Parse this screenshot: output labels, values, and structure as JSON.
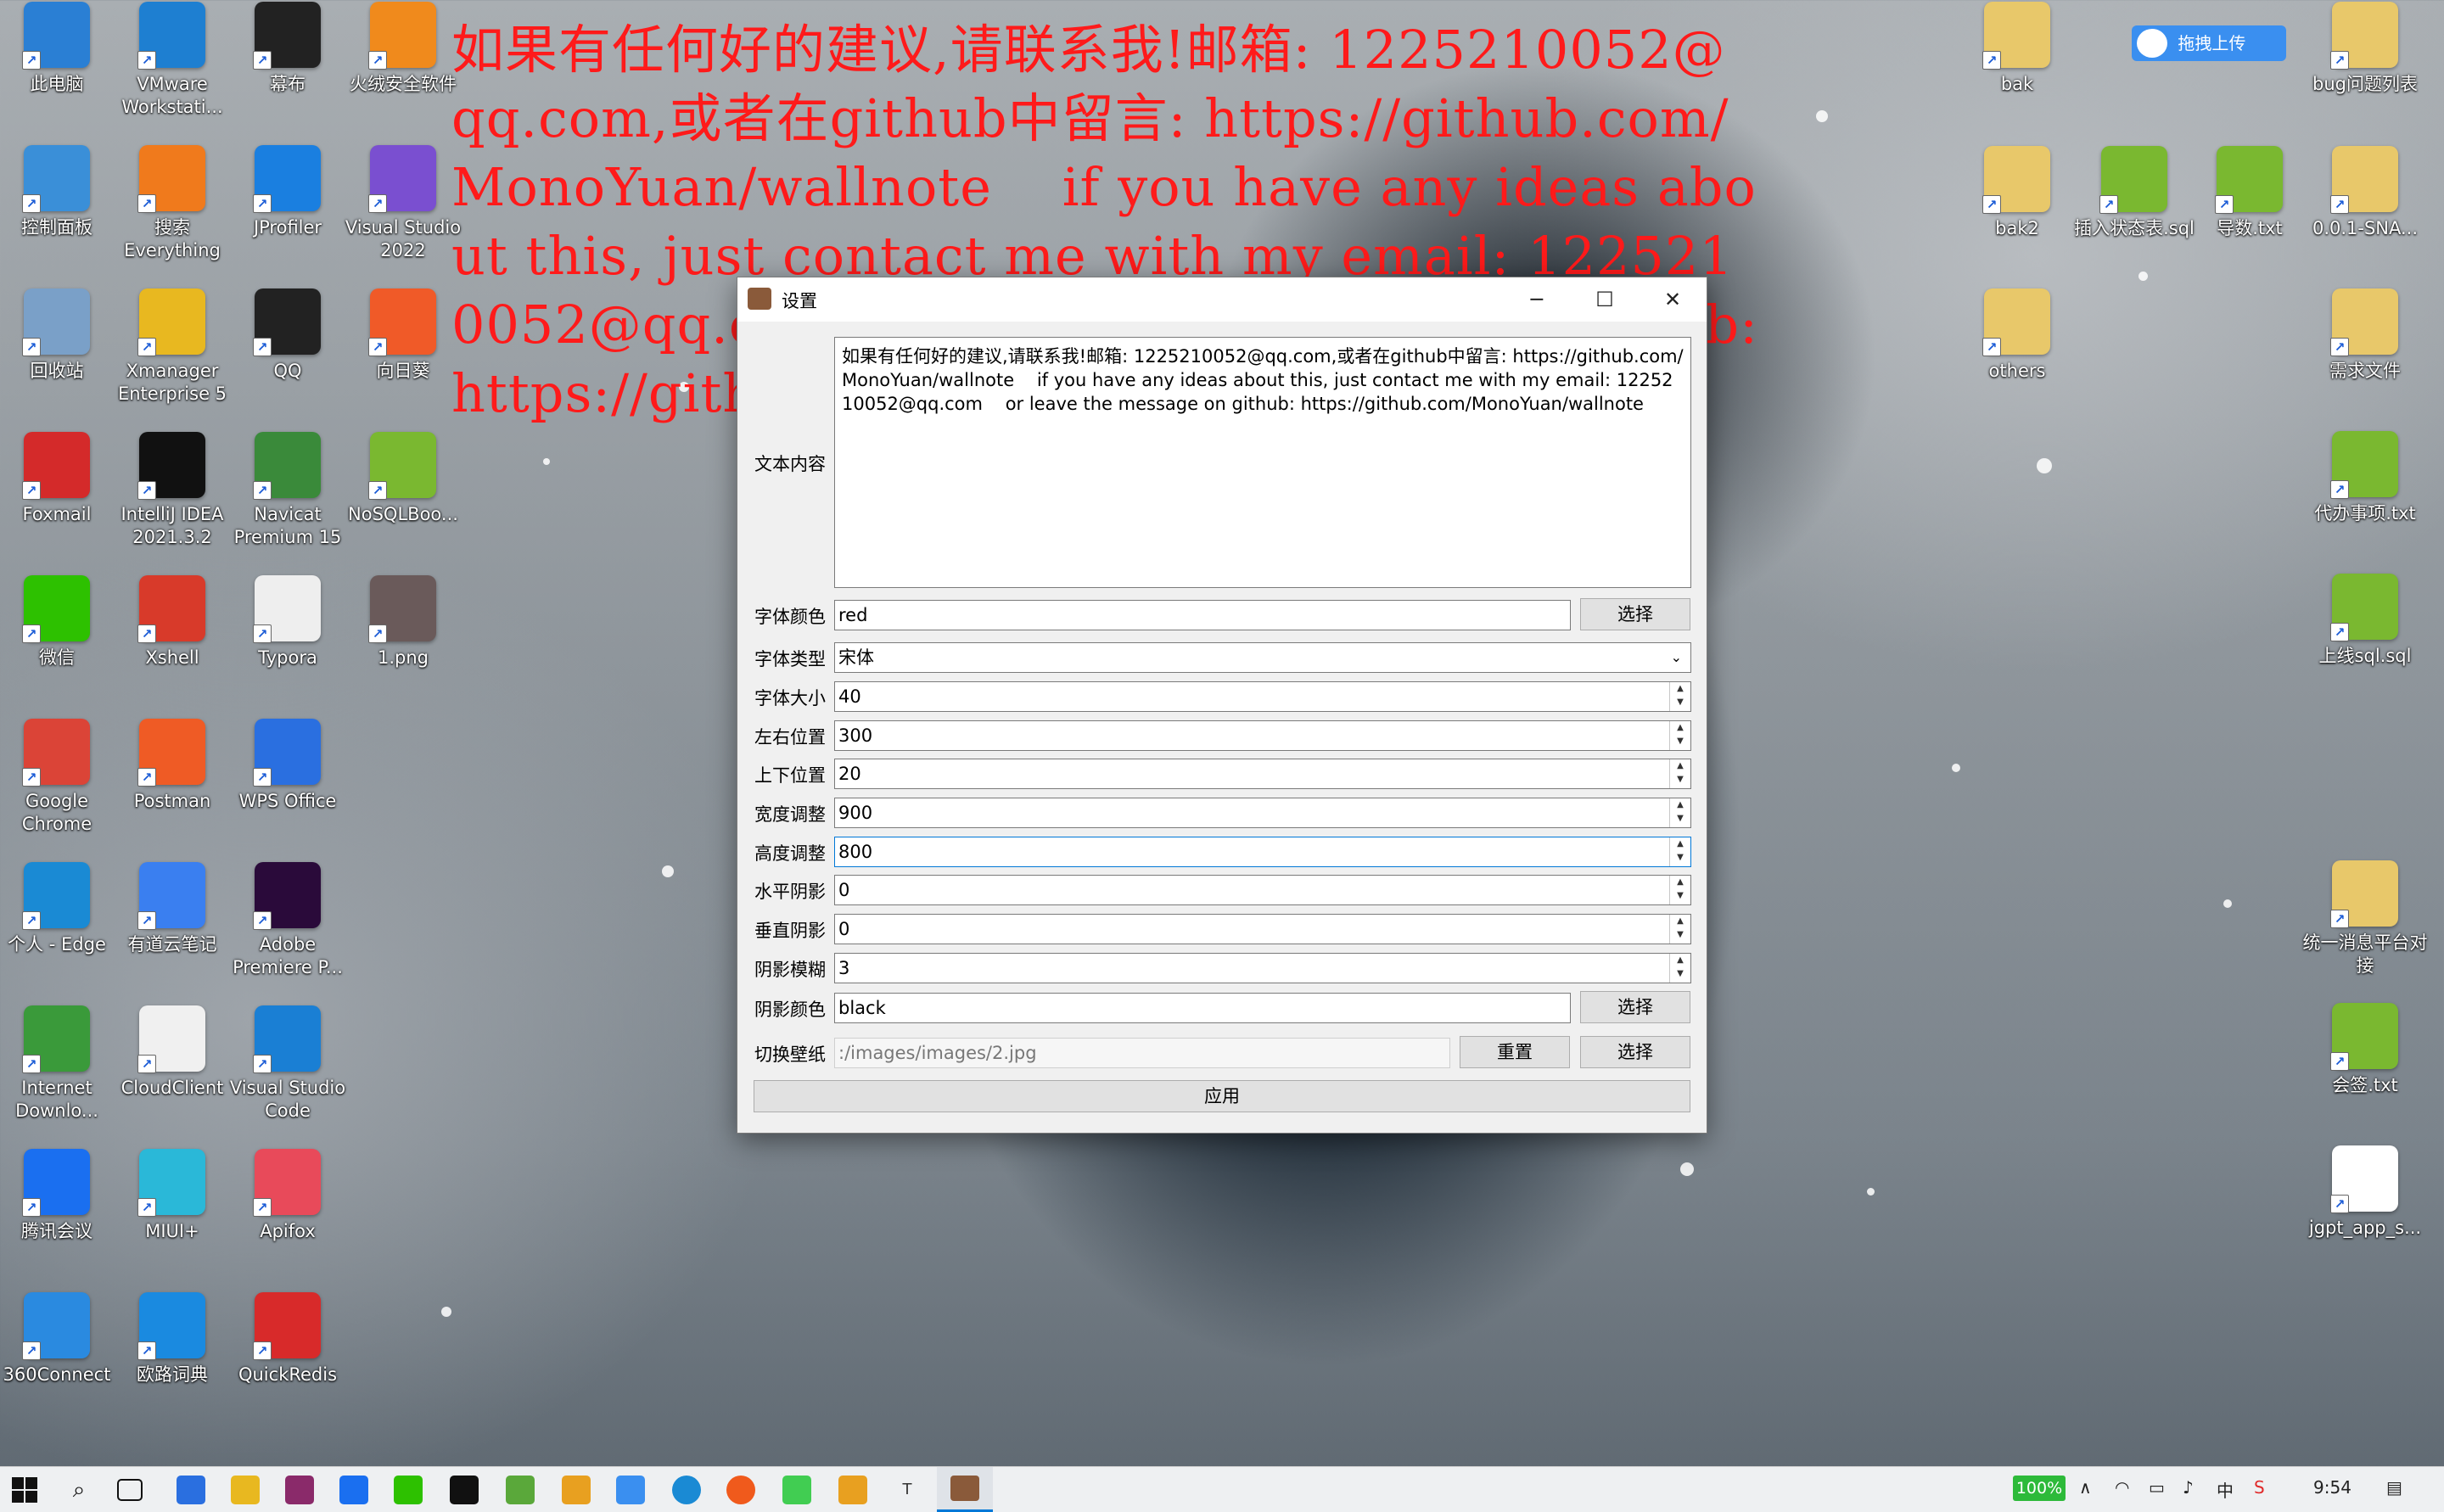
{
  "watermark": {
    "text": "如果有任何好的建议,请联系我!邮箱: 1225210052@qq.com,或者在github中留言: https://github.com/MonoYuan/wallnote    if you have any ideas about this, just contact me with my email: 1225210052@qq.com  or leave the message on github: https://github.com/MonoYuan/wallnote",
    "color": "#ff1a1a"
  },
  "desktop_icons_left": [
    {
      "label": "此电脑",
      "icon": "computer-icon",
      "color": "#2a7fd4"
    },
    {
      "label": "VMware Workstati...",
      "icon": "vmware-icon",
      "color": "#1e7fd1"
    },
    {
      "label": "幕布",
      "icon": "mubu-icon",
      "color": "#222222"
    },
    {
      "label": "火绒安全软件",
      "icon": "huorong-icon",
      "color": "#f08a1c"
    },
    {
      "label": "控制面板",
      "icon": "control-panel-icon",
      "color": "#3a8fd8"
    },
    {
      "label": "搜索 Everything",
      "icon": "everything-icon",
      "color": "#f07a1c"
    },
    {
      "label": "JProfiler",
      "icon": "jprofiler-icon",
      "color": "#1a7fe0"
    },
    {
      "label": "Visual Studio 2022",
      "icon": "visual-studio-icon",
      "color": "#7a4fd0"
    },
    {
      "label": "回收站",
      "icon": "recycle-bin-icon",
      "color": "#7aa0c8"
    },
    {
      "label": "Xmanager Enterprise 5",
      "icon": "xmanager-icon",
      "color": "#e8b820"
    },
    {
      "label": "QQ",
      "icon": "qq-icon",
      "color": "#222222"
    },
    {
      "label": "向日葵",
      "icon": "sunflower-icon",
      "color": "#f05a28"
    },
    {
      "label": "Foxmail",
      "icon": "foxmail-icon",
      "color": "#d42a2a"
    },
    {
      "label": "IntelliJ IDEA 2021.3.2",
      "icon": "intellij-icon",
      "color": "#111111"
    },
    {
      "label": "Navicat Premium 15",
      "icon": "navicat-icon",
      "color": "#3a8a3a"
    },
    {
      "label": "NoSQLBoo...",
      "icon": "nosqlbooster-icon",
      "color": "#7ab830"
    },
    {
      "label": "微信",
      "icon": "wechat-icon",
      "color": "#2dc100"
    },
    {
      "label": "Xshell",
      "icon": "xshell-icon",
      "color": "#d83a2a"
    },
    {
      "label": "Typora",
      "icon": "typora-icon",
      "color": "#eeeeee"
    },
    {
      "label": "1.png",
      "icon": "image-file-icon",
      "color": "#6a5a5a"
    },
    {
      "label": "Google Chrome",
      "icon": "chrome-icon",
      "color": "#db4437"
    },
    {
      "label": "Postman",
      "icon": "postman-icon",
      "color": "#ef5b25"
    },
    {
      "label": "WPS Office",
      "icon": "wps-icon",
      "color": "#2a6fe0"
    },
    {
      "label": "个人 - Edge",
      "icon": "edge-icon",
      "color": "#1a8ad4"
    },
    {
      "label": "有道云笔记",
      "icon": "youdao-note-icon",
      "color": "#3a7ff0"
    },
    {
      "label": "Adobe Premiere P...",
      "icon": "premiere-icon",
      "color": "#2a0a3a"
    },
    {
      "label": "Internet Downlo...",
      "icon": "idm-icon",
      "color": "#3a9a3a"
    },
    {
      "label": "CloudClient",
      "icon": "cloudclient-icon",
      "color": "#f0f0f0"
    },
    {
      "label": "Visual Studio Code",
      "icon": "vscode-icon",
      "color": "#1a7fd4"
    },
    {
      "label": "腾讯会议",
      "icon": "tencent-meeting-icon",
      "color": "#1a6ff0"
    },
    {
      "label": "MIUI+",
      "icon": "miui-icon",
      "color": "#2ab8d8"
    },
    {
      "label": "Apifox",
      "icon": "apifox-icon",
      "color": "#e84a5a"
    },
    {
      "label": "360Connect",
      "icon": "360connect-icon",
      "color": "#2a8ae0"
    },
    {
      "label": "欧路词典",
      "icon": "eudic-icon",
      "color": "#1a8ae0"
    },
    {
      "label": "QuickRedis",
      "icon": "quickredis-icon",
      "color": "#d82a2a"
    }
  ],
  "desktop_icons_right": [
    {
      "label": "bak",
      "icon": "folder-icon",
      "color": "#e8c86a"
    },
    {
      "label": "bug问题列表",
      "icon": "folder-icon",
      "color": "#e8c86a"
    },
    {
      "label": "bak2",
      "icon": "folder-icon",
      "color": "#e8c86a"
    },
    {
      "label": "插入状态表.sql",
      "icon": "sql-file-icon",
      "color": "#7ab830"
    },
    {
      "label": "导数.txt",
      "icon": "txt-file-icon",
      "color": "#7ab830"
    },
    {
      "label": "0.0.1-SNA...",
      "icon": "folder-icon",
      "color": "#e8c86a"
    },
    {
      "label": "others",
      "icon": "folder-icon",
      "color": "#e8c86a"
    },
    {
      "label": "需求文件",
      "icon": "folder-icon",
      "color": "#e8c86a"
    },
    {
      "label": "代办事项.txt",
      "icon": "txt-file-icon",
      "color": "#7ab830"
    },
    {
      "label": "上线sql.sql",
      "icon": "sql-file-icon",
      "color": "#7ab830"
    },
    {
      "label": "统一消息平台对接",
      "icon": "folder-icon",
      "color": "#e8c86a"
    },
    {
      "label": "会签.txt",
      "icon": "txt-file-icon",
      "color": "#7ab830"
    },
    {
      "label": "jgpt_app_s...",
      "icon": "7z-archive-icon",
      "color": "#ffffff"
    }
  ],
  "upload_widget": {
    "label": "拖拽上传"
  },
  "dialog": {
    "title": "设置",
    "minimize": "─",
    "maximize": "☐",
    "close": "✕",
    "content_label": "文本内容",
    "content_value": "如果有任何好的建议,请联系我!邮箱: 1225210052@qq.com,或者在github中留言: https://github.com/MonoYuan/wallnote    if you have any ideas about this, just contact me with my email: 1225210052@qq.com    or leave the message on github: https://github.com/MonoYuan/wallnote",
    "font_color_label": "字体颜色",
    "font_color_value": "red",
    "font_type_label": "字体类型",
    "font_type_value": "宋体",
    "font_size_label": "字体大小",
    "font_size_value": "40",
    "left_pos_label": "左右位置",
    "left_pos_value": "300",
    "top_pos_label": "上下位置",
    "top_pos_value": "20",
    "width_label": "宽度调整",
    "width_value": "900",
    "height_label": "高度调整",
    "height_value": "800",
    "h_shadow_label": "水平阴影",
    "h_shadow_value": "0",
    "v_shadow_label": "垂直阴影",
    "v_shadow_value": "0",
    "shadow_blur_label": "阴影模糊",
    "shadow_blur_value": "3",
    "shadow_color_label": "阴影颜色",
    "shadow_color_value": "black",
    "wallpaper_label": "切换壁纸",
    "wallpaper_value": ":/images/images/2.jpg",
    "choose": "选择",
    "reset": "重置",
    "apply": "应用"
  },
  "taskbar": {
    "battery": "100%",
    "ime": "中",
    "clock": "9:54"
  }
}
